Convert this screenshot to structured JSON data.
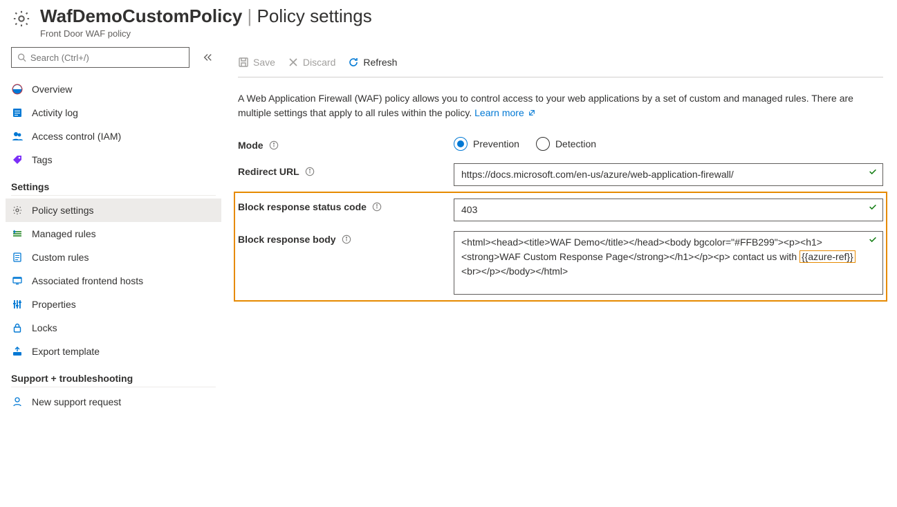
{
  "header": {
    "title_main": "WafDemoCustomPolicy",
    "title_sub": "Policy settings",
    "subtitle": "Front Door WAF policy"
  },
  "sidebar": {
    "search_placeholder": "Search (Ctrl+/)",
    "top_items": [
      {
        "label": "Overview"
      },
      {
        "label": "Activity log"
      },
      {
        "label": "Access control (IAM)"
      },
      {
        "label": "Tags"
      }
    ],
    "group_settings": "Settings",
    "settings_items": [
      {
        "label": "Policy settings"
      },
      {
        "label": "Managed rules"
      },
      {
        "label": "Custom rules"
      },
      {
        "label": "Associated frontend hosts"
      },
      {
        "label": "Properties"
      },
      {
        "label": "Locks"
      },
      {
        "label": "Export template"
      }
    ],
    "group_support": "Support + troubleshooting",
    "support_items": [
      {
        "label": "New support request"
      }
    ]
  },
  "toolbar": {
    "save": "Save",
    "discard": "Discard",
    "refresh": "Refresh"
  },
  "intro": {
    "text": "A Web Application Firewall (WAF) policy allows you to control access to your web applications by a set of custom and managed rules. There are multiple settings that apply to all rules within the policy. ",
    "link": "Learn more"
  },
  "form": {
    "mode_label": "Mode",
    "mode_options": {
      "prevention": "Prevention",
      "detection": "Detection"
    },
    "redirect_label": "Redirect URL",
    "redirect_value": "https://docs.microsoft.com/en-us/azure/web-application-firewall/",
    "status_label": "Block response status code",
    "status_value": "403",
    "body_label": "Block response body",
    "body_pre": "<html><head><title>WAF Demo</title></head><body bgcolor=\"#FFB299\"><p><h1><strong>WAF Custom Response Page</strong></h1></p><p> contact us with ",
    "body_highlight": "{{azure-ref}}",
    "body_post": "  <br></p></body></html>"
  }
}
